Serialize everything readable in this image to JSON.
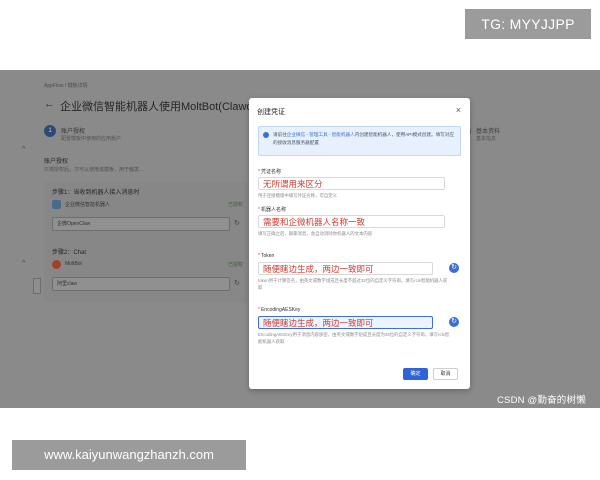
{
  "overlay_tags": {
    "tg": "TG: MYYJJPP",
    "url": "www.kaiyunwangzhanzh.com",
    "csdn": "CSDN @勤奋的树懒"
  },
  "app": {
    "breadcrumb": "AppFlow  /  模板详情",
    "page_title": "企业微信智能机器人使用MoltBot(Clawd",
    "steps": [
      {
        "index": "1",
        "title": "账户授权",
        "sub": "配置模板中使用的应用账户"
      },
      {
        "index": "5",
        "title": "基本资料",
        "sub": "基本信息"
      }
    ],
    "section_title": "账户授权",
    "section_sub": "只将授权后，才可以使用该模板，用于触发...",
    "cards": [
      {
        "header": "步骤1：当收到机器人接入消息时",
        "name": "企业微信智能机器人",
        "status": "已授权",
        "select": "企微OpenClaw"
      },
      {
        "header": "步骤2：Chat",
        "name": "MoltBot",
        "status": "已授权",
        "select": "阿里claw"
      }
    ]
  },
  "modal": {
    "title": "创建凭证",
    "close_glyph": "×",
    "notice": {
      "prefix": "请前往",
      "link": "企业微信 - 管理工具 - 智能机器人",
      "suffix": "内创建智能机器人，使用API模式创建。填写对应的接收消息服务器配置"
    },
    "fields": [
      {
        "label": "凭证名称",
        "value": "无所谓用来区分",
        "help": "用于连接模版中填写凭证名称，可自定义"
      },
      {
        "label": "机器人名称",
        "value": "需要和企微机器人名称一致",
        "help": "填写正确之后，群聊消息，会自动消除你机器人的文本内容"
      },
      {
        "label": "Token",
        "value": "随便瞎边生成，两边一致即可",
        "help": "token用于计算签名，由英文或数字组成且长度不超过32位的自定义字符串。填写rcls智能机器人获取"
      },
      {
        "label": "EncodingAESKey",
        "value": "随便瞎边生成，两边一致即可",
        "help": "EncodingAESKey用于消息内容加密，由英文或数字组成且长度为43位的自定义字符串。填写rcls智能机器人获取"
      }
    ],
    "gen_glyph": "↻",
    "ok": "确定",
    "cancel": "取消"
  },
  "colors": {
    "primary": "#2f64d6",
    "annotation_red": "#d03a2e",
    "dim_backdrop": "#7a7a7a"
  }
}
